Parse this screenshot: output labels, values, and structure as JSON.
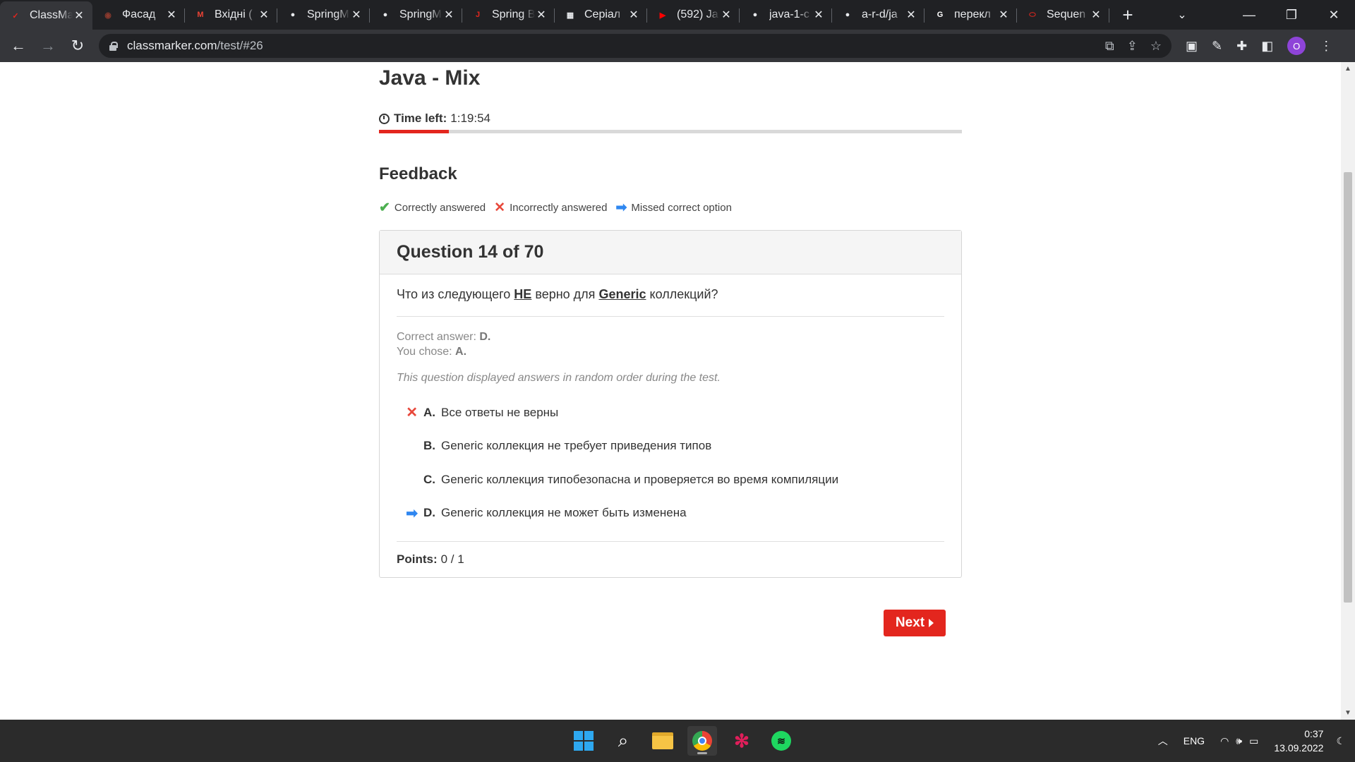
{
  "browser": {
    "tabs": [
      {
        "title": "ClassMarker",
        "favicon_color": "#e3261e",
        "favicon_glyph": "✓",
        "active": true
      },
      {
        "title": "Фасад",
        "favicon_color": "#8b3a2e",
        "favicon_glyph": "◉",
        "active": false
      },
      {
        "title": "Вхідні (",
        "favicon_color": "#ea4335",
        "favicon_glyph": "M",
        "active": false
      },
      {
        "title": "SpringM",
        "favicon_color": "#e8eaed",
        "favicon_glyph": "●",
        "active": false
      },
      {
        "title": "SpringM",
        "favicon_color": "#e8eaed",
        "favicon_glyph": "●",
        "active": false
      },
      {
        "title": "Spring B",
        "favicon_color": "#e3261e",
        "favicon_glyph": "J",
        "active": false
      },
      {
        "title": "Серіал",
        "favicon_color": "#e8eaed",
        "favicon_glyph": "▦",
        "active": false
      },
      {
        "title": "(592) Ja",
        "favicon_color": "#ff0000",
        "favicon_glyph": "▶",
        "active": false
      },
      {
        "title": "java-1-c",
        "favicon_color": "#e8eaed",
        "favicon_glyph": "●",
        "active": false
      },
      {
        "title": "a-r-d/ja",
        "favicon_color": "#e8eaed",
        "favicon_glyph": "●",
        "active": false
      },
      {
        "title": "перекл",
        "favicon_color": "#ffffff",
        "favicon_glyph": "G",
        "active": false
      },
      {
        "title": "Sequen",
        "favicon_color": "#e3261e",
        "favicon_glyph": "⬭",
        "active": false
      }
    ],
    "url_host": "classmarker.com",
    "url_path": "/test/#26",
    "profile_initial": "O"
  },
  "page": {
    "test_title": "Java - Mix",
    "timer_label": "Time left:",
    "timer_value": "1:19:54",
    "timer_progress_fraction": 0.12,
    "feedback_heading": "Feedback",
    "legend": {
      "correct": "Correctly answered",
      "incorrect": "Incorrectly answered",
      "missed": "Missed correct option"
    },
    "question": {
      "header": "Question 14 of 70",
      "text_before": "Что из следующего",
      "text_em1": "НЕ",
      "text_mid": "верно для",
      "text_em2": "Generic",
      "text_after": "коллекций?",
      "correct_label": "Correct answer:",
      "correct_value": "D.",
      "chose_label": "You chose:",
      "chose_value": "A.",
      "random_note": "This question displayed answers in random order during the test.",
      "options": [
        {
          "letter": "A.",
          "text": "Все ответы не верны",
          "marker": "incorrect"
        },
        {
          "letter": "B.",
          "text": "Generic коллекция не требует приведения типов",
          "marker": ""
        },
        {
          "letter": "C.",
          "text": "Generic коллекция типобезопасна и проверяется во время компиляции",
          "marker": ""
        },
        {
          "letter": "D.",
          "text": "Generic коллекция не может быть изменена",
          "marker": "missed"
        }
      ],
      "points_label": "Points:",
      "points_value": "0 / 1"
    },
    "next_label": "Next"
  },
  "taskbar": {
    "language": "ENG",
    "time": "0:37",
    "date": "13.09.2022"
  },
  "colors": {
    "accent_red": "#e3261e",
    "correct_green": "#4caf50",
    "incorrect_red": "#e8483b",
    "missed_blue": "#2f87f0"
  }
}
